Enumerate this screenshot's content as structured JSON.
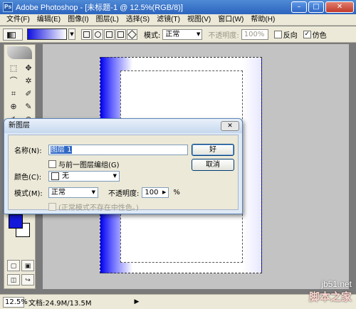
{
  "window": {
    "app_icon": "Ps",
    "title": "Adobe Photoshop - [未标题-1 @ 12.5%(RGB/8)]",
    "minimize": "–",
    "maximize": "□",
    "close": "✕"
  },
  "menubar": {
    "items": [
      "文件(F)",
      "编辑(E)",
      "图像(I)",
      "图层(L)",
      "选择(S)",
      "滤镜(T)",
      "视图(V)",
      "窗口(W)",
      "帮助(H)"
    ]
  },
  "options": {
    "mode_label": "模式:",
    "mode_value": "正常",
    "opacity_label": "不透明度:",
    "opacity_value": "100%",
    "reverse_label": "反向",
    "dither_label": "仿色",
    "gradient_colors": [
      "#1010e0",
      "#ffffff"
    ]
  },
  "toolbox": {
    "tools": [
      "⬚",
      "✥",
      "⌒",
      "✲",
      "⌗",
      "✐",
      "⊕",
      "✎",
      "✍",
      "⊛",
      "◐",
      "◍",
      "T",
      "↖",
      "◇",
      "▭",
      "☞",
      "✋",
      "⌕",
      "☐"
    ],
    "mode_buttons": [
      "▢",
      "▣",
      "◫",
      "↪"
    ],
    "foreground_color": "#1418d8",
    "background_color": "#ffffff"
  },
  "statusbar": {
    "zoom": "12.5%",
    "doc_info": "文档:24.9M/13.5M",
    "arrow": "▶"
  },
  "dialog": {
    "title": "新图层",
    "close": "✕",
    "name_label": "名称(N):",
    "name_value": "图层 1",
    "group_label": "与前一图层编组(G)",
    "color_label": "颜色(C):",
    "color_value": "无",
    "mode_label": "模式(M):",
    "mode_value": "正常",
    "opacity_label": "不透明度:",
    "opacity_value": "100",
    "opacity_unit": "%",
    "neutral_label": "(正常模式不存在中性色。)",
    "ok_label": "好",
    "cancel_label": "取消"
  },
  "watermark": {
    "url": "jb51.net",
    "brand": "脚本之家"
  }
}
